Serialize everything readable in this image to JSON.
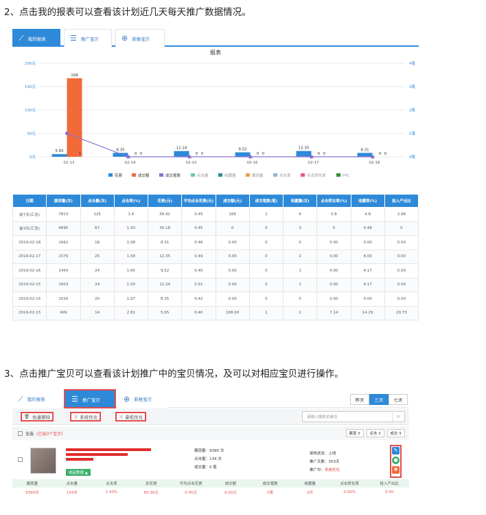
{
  "headings": {
    "step2": "2、点击我的报表可以查看该计划近几天每天推广数据情况。",
    "step3": "3、点击推广宝贝可以查看该计划推广中的宝贝情况，及可以对相应宝贝进行操作。"
  },
  "tabs": [
    {
      "label": "我的报表",
      "icon": "chart-icon"
    },
    {
      "label": "推广宝贝",
      "icon": "list-icon"
    },
    {
      "label": "新推宝贝",
      "icon": "plus-circle-icon"
    }
  ],
  "colors": {
    "accent": "#2e8ad8",
    "bar_cost": "#2e8ad8",
    "bar_deal": "#f26a3a",
    "line": "#8a6fd0",
    "highlight": "#e34b4b"
  },
  "chart_data": {
    "type": "bar",
    "title": "报表",
    "categories": [
      "02-13",
      "02-14",
      "02-15",
      "02-16",
      "02-17",
      "02-18"
    ],
    "series": [
      {
        "name": "花费",
        "axis": "left",
        "values": [
          5.65,
          8.35,
          12.24,
          9.52,
          12.35,
          8.31
        ]
      },
      {
        "name": "成交额",
        "axis": "left",
        "values": [
          168,
          0,
          0,
          0,
          0,
          0
        ]
      },
      {
        "name": "成交笔数",
        "axis": "right",
        "type": "line",
        "values": [
          1,
          0,
          0,
          0,
          0,
          0
        ]
      }
    ],
    "y_left": {
      "ticks": [
        "0元",
        "50元",
        "100元",
        "150元",
        "200元"
      ],
      "lim": [
        0,
        200
      ]
    },
    "y_right": {
      "ticks": [
        "0笔",
        "1笔",
        "2笔",
        "3笔",
        "4笔"
      ],
      "lim": [
        0,
        4
      ]
    },
    "bar_labels": [
      [
        "5.65",
        "168",
        "1"
      ],
      [
        "8.35",
        "0",
        "0"
      ],
      [
        "12.24",
        "0",
        "0"
      ],
      [
        "9.52",
        "0",
        "0"
      ],
      [
        "12.35",
        "0",
        "0"
      ],
      [
        "8.31",
        "0",
        "0"
      ]
    ],
    "legend": [
      "花费",
      "成交额",
      "成交笔数",
      "点击量",
      "收藏量",
      "展现量",
      "点击率",
      "点击转化率",
      "PPC"
    ]
  },
  "report_table": {
    "headers": [
      "日期",
      "展现量(次)",
      "点击量(次)",
      "点击率(%)",
      "花费(元)",
      "平均点击花费(元)",
      "成交额(元)",
      "成交笔数(笔)",
      "收藏量(次)",
      "点击转化率(%)",
      "收藏率(%)",
      "投入产出比"
    ],
    "rows": [
      [
        "前7天(汇总)",
        "7813",
        "125",
        "1.6",
        "56.42",
        "0.45",
        "168",
        "1",
        "6",
        "0.8",
        "4.8",
        "2.98"
      ],
      [
        "前3天(汇总)",
        "4695",
        "67",
        "1.43",
        "30.18",
        "0.45",
        "0",
        "0",
        "3",
        "0",
        "4.48",
        "0"
      ],
      [
        "2019-02-18",
        "1662",
        "18",
        "1.08",
        "8.31",
        "0.46",
        "0.00",
        "0",
        "0",
        "0.00",
        "0.00",
        "0.00"
      ],
      [
        "2019-02-17",
        "1579",
        "25",
        "1.58",
        "12.35",
        "0.49",
        "0.00",
        "0",
        "2",
        "0.00",
        "8.00",
        "0.00"
      ],
      [
        "2019-02-16",
        "1454",
        "24",
        "1.65",
        "9.52",
        "0.40",
        "0.00",
        "0",
        "1",
        "0.00",
        "4.17",
        "0.00"
      ],
      [
        "2019-02-15",
        "1603",
        "24",
        "1.50",
        "12.24",
        "0.51",
        "0.00",
        "0",
        "1",
        "0.00",
        "4.17",
        "0.00"
      ],
      [
        "2019-02-14",
        "1016",
        "20",
        "1.97",
        "8.35",
        "0.42",
        "0.00",
        "0",
        "0",
        "0.00",
        "0.00",
        "0.00"
      ],
      [
        "2019-02-13",
        "499",
        "14",
        "2.81",
        "5.65",
        "0.40",
        "168.00",
        "1",
        "2",
        "7.14",
        "14.29",
        "29.73"
      ]
    ]
  },
  "s2": {
    "tabs": [
      {
        "label": "我的报表",
        "icon": "chart-icon"
      },
      {
        "label": "推广宝贝",
        "icon": "list-icon"
      },
      {
        "label": "新推宝贝",
        "icon": "plus-circle-icon"
      }
    ],
    "ranges": [
      "昨天",
      "三天",
      "七天"
    ],
    "toolbar": {
      "delete": "批量删除",
      "sys_opt": "系统优化",
      "smart_opt": "豪拓优化",
      "search_ph": "请输入搜索关键词"
    },
    "select_all": "全选",
    "selected": "(已选0个宝贝)",
    "sorts": [
      "展现 ⇕",
      "点击 ⇕",
      "成交 ⇕"
    ],
    "item": {
      "impressions": "展现量：9390 次",
      "clicks": "点击量：134 次",
      "deals": "成交量：0 笔",
      "review": "审核状态：上线",
      "days": "推广天数：353天",
      "promoting": "推广中：",
      "promoting_val": "系统优化",
      "tag": "收起数据 ▲"
    },
    "metrics_headers": [
      "展现量",
      "点击量",
      "点击率",
      "总花费",
      "平均点击花费",
      "成交额",
      "成交笔数",
      "收藏量",
      "点击转化率",
      "投入产出比"
    ],
    "metrics_values": [
      "9390次",
      "134次",
      "1.43%",
      "60.36元",
      "0.45元",
      "0.00元",
      "0笔",
      "3次",
      "0.00%",
      "0.00"
    ]
  }
}
